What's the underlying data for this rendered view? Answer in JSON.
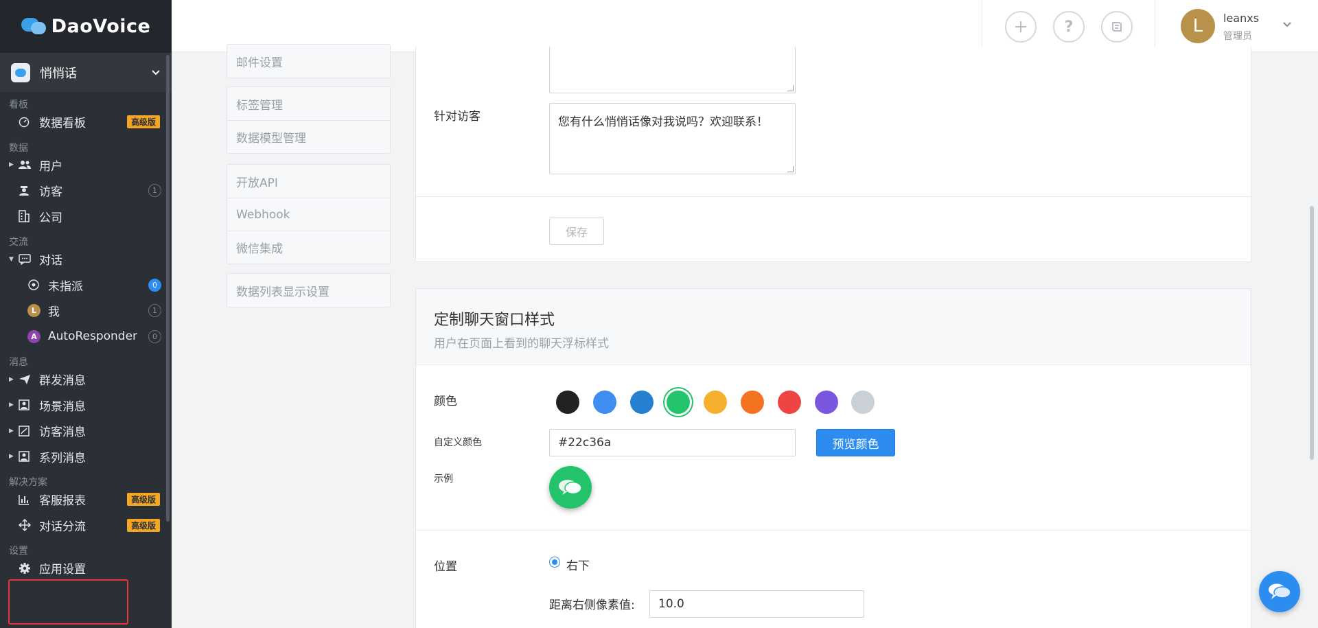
{
  "app": {
    "name": "DaoVoice"
  },
  "workspace": {
    "name": "悄悄话"
  },
  "sidebar": {
    "sections": {
      "dashboard": "看板",
      "data": "数据",
      "communication": "交流",
      "messages": "消息",
      "solutions": "解决方案",
      "settings": "设置"
    },
    "items": {
      "dashboard": "数据看板",
      "users": "用户",
      "visitors": "访客",
      "companies": "公司",
      "conversations": "对话",
      "unassigned": "未指派",
      "me": "我",
      "autoresponder": "AutoResponder",
      "broadcast": "群发消息",
      "scene": "场景消息",
      "visitor_msg": "访客消息",
      "series": "系列消息",
      "reports": "客服报表",
      "routing": "对话分流",
      "app_settings": "应用设置"
    },
    "badges": {
      "pro": "高级版"
    },
    "counts": {
      "visitors": "1",
      "unassigned": "0",
      "me": "1",
      "autoresponder": "0"
    },
    "avatars": {
      "me": "L",
      "autoresponder": "A"
    }
  },
  "topbar": {
    "user_initial": "L",
    "user_name": "leanxs",
    "user_role": "管理员"
  },
  "settings_menu": {
    "email": "邮件设置",
    "tags": "标签管理",
    "data_model": "数据模型管理",
    "open_api": "开放API",
    "webhook": "Webhook",
    "wechat": "微信集成",
    "list_display": "数据列表显示设置"
  },
  "greeting_card": {
    "visitor_label": "针对访客",
    "visitor_text": "您有什么悄悄话像对我说吗？欢迎联系！",
    "save": "保存"
  },
  "style_card": {
    "title": "定制聊天窗口样式",
    "subtitle": "用户在页面上看到的聊天浮标样式",
    "color_label": "颜色",
    "custom_color_label": "自定义颜色",
    "custom_color_value": "#22c36a",
    "preview_button": "预览颜色",
    "sample_label": "示例",
    "position_label": "位置",
    "position_value": "右下",
    "right_offset_label": "距离右侧像素值:",
    "right_offset_value": "10.0",
    "swatches": [
      "#222222",
      "#3d8ef0",
      "#2580d0",
      "#22c36a",
      "#f5b02e",
      "#f47321",
      "#ef4444",
      "#7b57e0",
      "#cbd0d6"
    ],
    "selected_color": "#22c36a"
  }
}
